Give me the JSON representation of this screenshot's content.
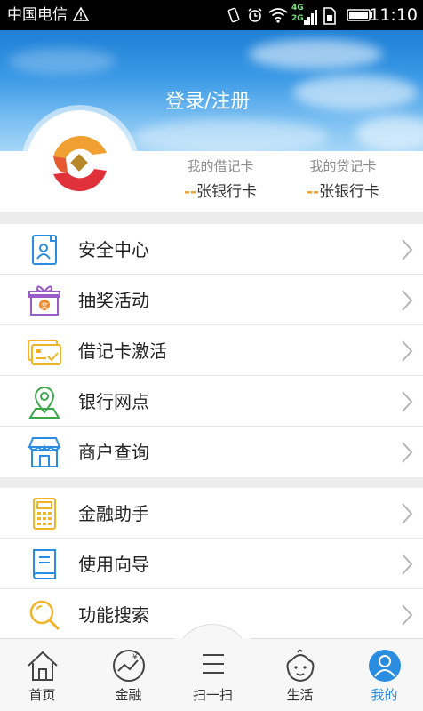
{
  "status_bar": {
    "carrier": "中国电信",
    "time": "11:10",
    "network_4g": "4G",
    "network_2g": "2G"
  },
  "header": {
    "login_label": "登录/注册"
  },
  "cards": [
    {
      "title": "我的借记卡",
      "dash": "--",
      "value": "张银行卡"
    },
    {
      "title": "我的贷记卡",
      "dash": "--",
      "value": "张银行卡"
    }
  ],
  "menu_group_1": [
    {
      "label": "安全中心",
      "icon": "security-id-icon"
    },
    {
      "label": "抽奖活动",
      "icon": "gift-icon"
    },
    {
      "label": "借记卡激活",
      "icon": "card-activate-icon"
    },
    {
      "label": "银行网点",
      "icon": "location-pin-icon"
    },
    {
      "label": "商户查询",
      "icon": "shop-icon"
    }
  ],
  "menu_group_2": [
    {
      "label": "金融助手",
      "icon": "calculator-icon"
    },
    {
      "label": "使用向导",
      "icon": "guide-book-icon"
    },
    {
      "label": "功能搜索",
      "icon": "search-icon"
    }
  ],
  "gift_glyph": "奖",
  "finance_glyph": "¥",
  "tabs": [
    {
      "label": "首页",
      "icon": "home-icon"
    },
    {
      "label": "金融",
      "icon": "finance-chart-icon"
    },
    {
      "label": "扫一扫",
      "icon": "scan-icon"
    },
    {
      "label": "生活",
      "icon": "baby-face-icon"
    },
    {
      "label": "我的",
      "icon": "user-icon",
      "active": true
    }
  ],
  "colors": {
    "accent": "#2b8de0",
    "brand_orange": "#f0a030",
    "brand_red": "#e0303a"
  }
}
